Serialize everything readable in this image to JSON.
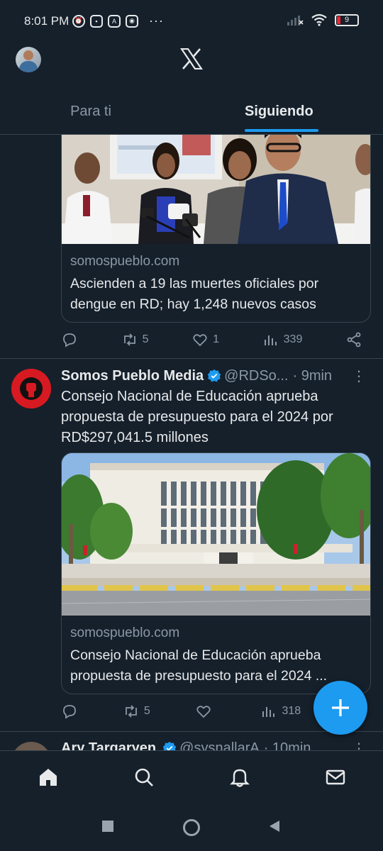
{
  "status": {
    "time": "8:01 PM",
    "battery": "9"
  },
  "header": {
    "tabs": [
      {
        "label": "Para ti"
      },
      {
        "label": "Siguiendo"
      }
    ]
  },
  "tweet1": {
    "card": {
      "domain": "somospueblo.com",
      "title": "Ascienden a 19 las muertes oficiales por dengue en RD; hay 1,248 nuevos casos"
    },
    "stats": {
      "retweets": "5",
      "likes": "1",
      "views": "339"
    }
  },
  "tweet2": {
    "name": "Somos Pueblo Media",
    "handle": "@RDSo...",
    "time": "· 9min",
    "text": "Consejo Nacional de Educación aprueba propuesta de presupuesto para el 2024 por RD$297,041.5 millones",
    "card": {
      "domain": "somospueblo.com",
      "title": "Consejo Nacional de Educación aprueba propuesta de presupuesto para el 2024 ..."
    },
    "stats": {
      "retweets": "5",
      "likes": "",
      "views": "318"
    }
  },
  "tweet3": {
    "name": "Ary Targaryen",
    "handle": "@sysnallarA",
    "time": "· 10min"
  },
  "colors": {
    "accent": "#1d9bf0",
    "background": "#15202b",
    "border": "#38444d",
    "muted": "#8b98a5"
  },
  "icons": {
    "nav": [
      "home-icon",
      "search-icon",
      "notifications-icon",
      "messages-icon"
    ],
    "actions": [
      "reply-icon",
      "retweet-icon",
      "like-icon",
      "views-icon",
      "share-icon"
    ],
    "system": [
      "recents-icon",
      "home-circle-icon",
      "back-icon"
    ]
  }
}
